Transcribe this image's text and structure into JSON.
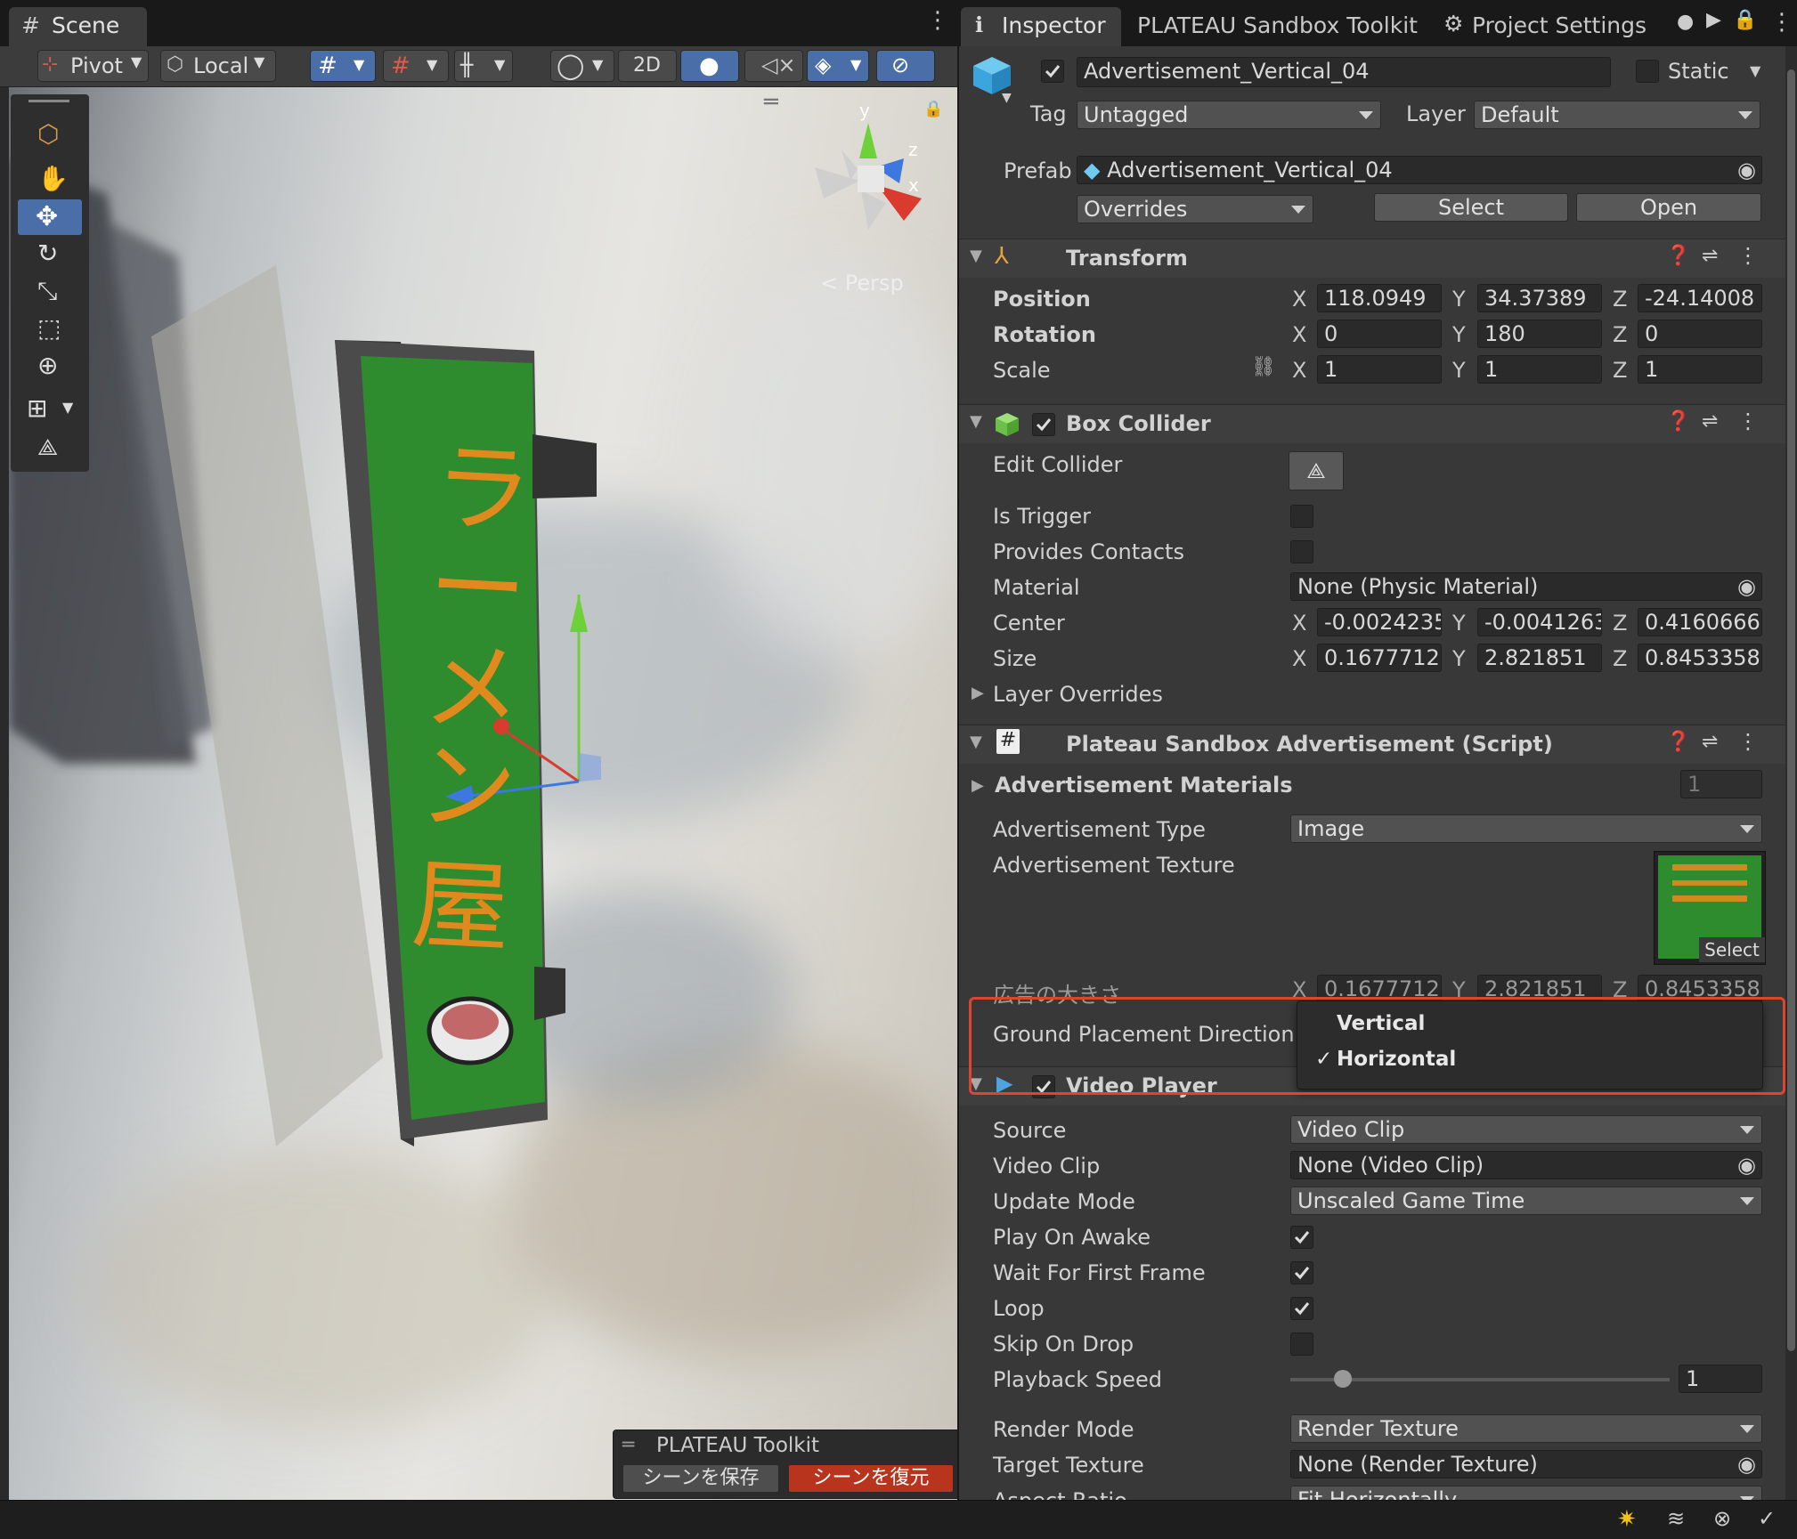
{
  "scene": {
    "tab_label": "Scene",
    "toolbar": {
      "pivot": "Pivot",
      "local": "Local",
      "mode_2d": "2D"
    },
    "gizmo": {
      "axis_x": "x",
      "axis_y": "y",
      "axis_z": "z",
      "projection": "Persp"
    },
    "sign_text": [
      "ラ",
      "ー",
      "メ",
      "ン",
      "屋"
    ],
    "overlay": {
      "title": "PLATEAU Toolkit",
      "save_scene": "シーンを保存",
      "restore_scene": "シーンを復元"
    }
  },
  "inspector": {
    "tabs": {
      "inspector": "Inspector",
      "sandbox": "PLATEAU Sandbox Toolkit",
      "project_settings": "Project Settings"
    },
    "object": {
      "name": "Advertisement_Vertical_04",
      "static_label": "Static",
      "tag_label": "Tag",
      "tag_value": "Untagged",
      "layer_label": "Layer",
      "layer_value": "Default",
      "prefab_label": "Prefab",
      "prefab_value": "Advertisement_Vertical_04",
      "overrides": "Overrides",
      "select": "Select",
      "open": "Open"
    },
    "transform": {
      "title": "Transform",
      "position_label": "Position",
      "position": [
        "118.0949",
        "34.37389",
        "-24.14008"
      ],
      "rotation_label": "Rotation",
      "rotation": [
        "0",
        "180",
        "0"
      ],
      "scale_label": "Scale",
      "scale": [
        "1",
        "1",
        "1"
      ],
      "axes": [
        "X",
        "Y",
        "Z"
      ]
    },
    "box_collider": {
      "title": "Box Collider",
      "edit_collider": "Edit Collider",
      "is_trigger": "Is Trigger",
      "provides_contacts": "Provides Contacts",
      "material_label": "Material",
      "material_value": "None (Physic Material)",
      "center_label": "Center",
      "center": [
        "-0.0024235",
        "-0.0041263",
        "0.4160666"
      ],
      "size_label": "Size",
      "size": [
        "0.1677712",
        "2.821851",
        "0.8453358"
      ],
      "layer_overrides": "Layer Overrides"
    },
    "ad_script": {
      "title": "Plateau Sandbox Advertisement (Script)",
      "materials_label": "Advertisement Materials",
      "materials_count": "1",
      "type_label": "Advertisement Type",
      "type_value": "Image",
      "texture_label": "Advertisement Texture",
      "texture_select": "Select",
      "size_label": "広告の大きさ",
      "size": [
        "0.1677712",
        "2.821851",
        "0.8453358"
      ],
      "ground_label": "Ground Placement Direction",
      "menu": {
        "option1": "Vertical",
        "option2": "Horizontal",
        "selected": "Horizontal"
      }
    },
    "video_player": {
      "title": "Video Player",
      "source_label": "Source",
      "source_value": "Video Clip",
      "clip_label": "Video Clip",
      "clip_value": "None (Video Clip)",
      "update_label": "Update Mode",
      "update_value": "Unscaled Game Time",
      "play_on_awake": "Play On Awake",
      "wait_first_frame": "Wait For First Frame",
      "loop": "Loop",
      "skip_on_drop": "Skip On Drop",
      "speed_label": "Playback Speed",
      "speed_value": "1",
      "speed_fraction": 0.12,
      "render_mode_label": "Render Mode",
      "render_mode_value": "Render Texture",
      "target_label": "Target Texture",
      "target_value": "None (Render Texture)",
      "aspect_label": "Aspect Ratio",
      "aspect_value": "Fit Horizontally"
    }
  },
  "colors": {
    "highlight_border": "#e0442f",
    "accent_blue": "#4a6ea8",
    "sign_green": "#2e8b2e",
    "sign_text": "#e08a1e"
  }
}
